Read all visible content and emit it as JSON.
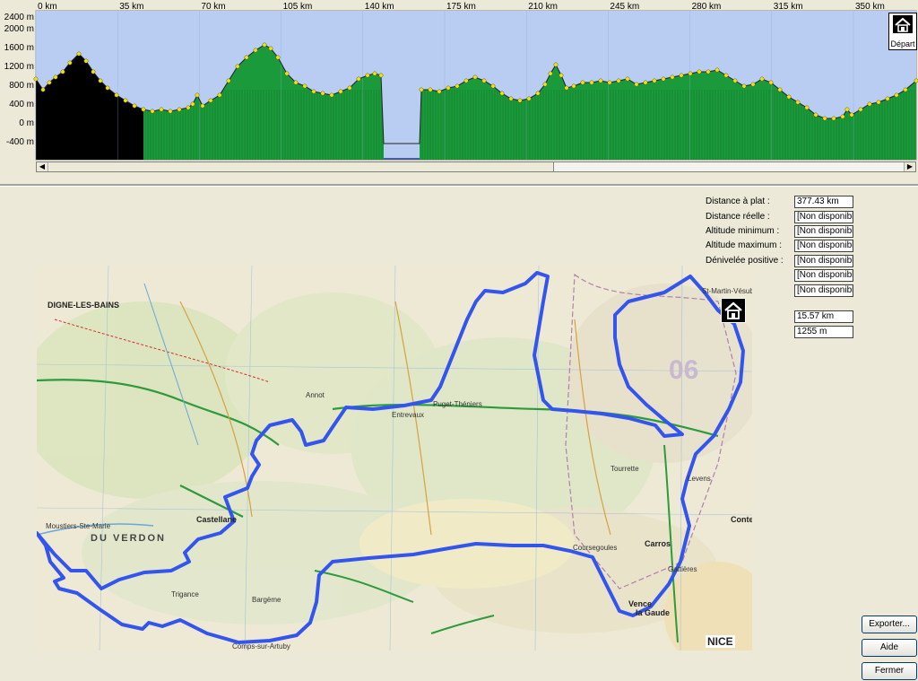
{
  "profile": {
    "km_ticks": [
      "0 km",
      "35 km",
      "70 km",
      "105 km",
      "140 km",
      "175 km",
      "210 km",
      "245 km",
      "280 km",
      "315 km",
      "350 km"
    ],
    "altitude_ticks": [
      "2400 m",
      "2000 m",
      "1600 m",
      "1200 m",
      "800 m",
      "400 m",
      "0 m",
      "-400 m"
    ],
    "start_label": "Départ",
    "colors": {
      "sky": "#b9cdf3",
      "ground_dark": "#000000",
      "ground_green": "#1a9a3a",
      "points": "#f0e020"
    }
  },
  "stats": {
    "flat_distance_label": "Distance à plat :",
    "flat_distance_value": "377.43 km",
    "real_distance_label": "Distance réelle :",
    "real_distance_value": "[Non disponible]",
    "min_altitude_label": "Altitude minimum :",
    "min_altitude_value": "[Non disponible]",
    "max_altitude_label": "Altitude maximum :",
    "max_altitude_value": "[Non disponible]",
    "positive_elevation_label": "Dénivelée positive :",
    "positive_elevation_value": "[Non disponible]",
    "extra_value_1": "[Non disponible]",
    "extra_value_2": "[Non disponible]",
    "cursor_distance_value": "15.57 km",
    "cursor_altitude_value": "1255 m"
  },
  "map": {
    "towns": {
      "digne": "DIGNE-LES-BAINS",
      "castellane": "Castellane",
      "nice": "NICE",
      "verdon": "DU    VERDON",
      "carros": "Carros",
      "vence": "Vence",
      "gaude": "la Gaude",
      "contes": "Contes",
      "entrevaux": "Entrevaux",
      "puget": "Puget-Théniers",
      "st_martin": "St-Martin-Vésubie",
      "levens": "Levens",
      "comps": "Comps-sur-Artuby",
      "bargeme": "Bargème",
      "trigance": "Trigance",
      "moustiers": "Moustiers-Ste-Marie",
      "annot": "Annot",
      "tourrette": "Tourrette",
      "coursegoules": "Coursegoules",
      "gattieres": "Gattières",
      "dept": "06"
    },
    "route_color": "#3355ee"
  },
  "buttons": {
    "export": "Exporter...",
    "help": "Aide",
    "close": "Fermer"
  }
}
